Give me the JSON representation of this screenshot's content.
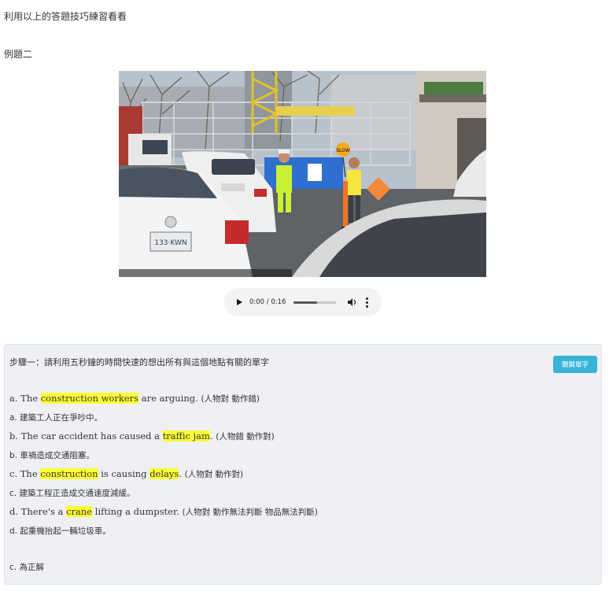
{
  "intro_text": "利用以上的答題技巧練習看看",
  "example_title": "例題二",
  "audio": {
    "time": "0:00 / 0:16",
    "progress_fraction": 0.55
  },
  "panel": {
    "step_text": "步驟一：請利用五秒鐘的時間快速的想出所有與這個地點有關的單字",
    "keyword_button": "關鍵單字",
    "options": [
      {
        "parts": [
          {
            "text": "a. The ",
            "hl": false
          },
          {
            "text": "construction workers",
            "hl": true
          },
          {
            "text": " are arguing. ",
            "hl": false
          }
        ],
        "note": "(人物對 動作錯)",
        "translation": "a. 建築工人正在爭吵中。"
      },
      {
        "parts": [
          {
            "text": "b. The car accident has caused a ",
            "hl": false
          },
          {
            "text": "traffic jam",
            "hl": true
          },
          {
            "text": ". ",
            "hl": false
          }
        ],
        "note": "(人物錯 動作對)",
        "translation": "b. 車禍造成交通阻塞。"
      },
      {
        "parts": [
          {
            "text": "c. The ",
            "hl": false
          },
          {
            "text": "construction",
            "hl": true
          },
          {
            "text": " is causing ",
            "hl": false
          },
          {
            "text": "delays",
            "hl": true
          },
          {
            "text": ". ",
            "hl": false
          }
        ],
        "note": "(人物對 動作對)",
        "translation": "c. 建築工程正造成交通速度減緩。"
      },
      {
        "parts": [
          {
            "text": "d. There's a ",
            "hl": false
          },
          {
            "text": "crane",
            "hl": true
          },
          {
            "text": " lifting a dumpster. ",
            "hl": false
          }
        ],
        "note": "(人物對 動作無法判斷 物品無法判斷)",
        "translation": "d. 起重機抬起一輛垃圾車。"
      }
    ],
    "answer": "c. 為正解"
  },
  "photo": {
    "plate_text": "133·KWN",
    "sign_text": "SLOW"
  },
  "colors": {
    "highlight": "#ffff33",
    "button": "#39b4d9",
    "panel_bg": "#eef0f4"
  }
}
